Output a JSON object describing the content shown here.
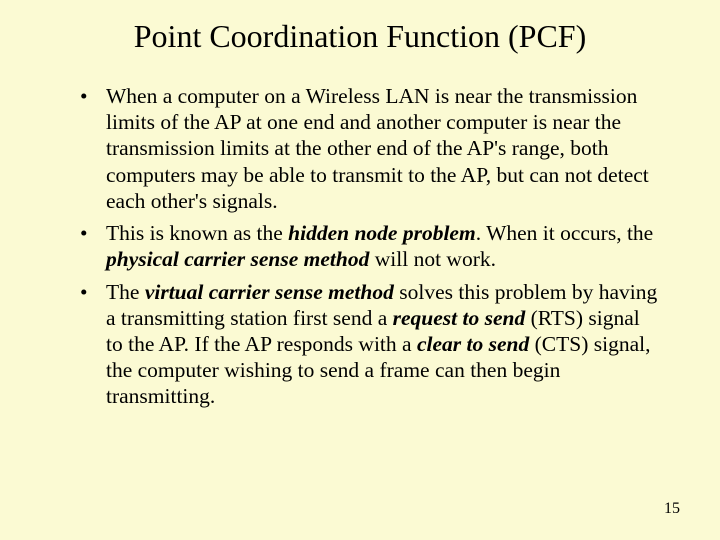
{
  "title": "Point Coordination Function (PCF)",
  "bullets": {
    "b1": {
      "t1": "When a computer on a Wireless LAN is near the transmission limits of the AP at one end and another computer is near the transmission limits at the other end of the AP's range, both computers may be able to transmit to the AP, but can not detect each other's signals."
    },
    "b2": {
      "t1": "This is known as the ",
      "e1": "hidden node problem",
      "t2": ". When it occurs, the ",
      "e2": "physical carrier sense method",
      "t3": " will not work."
    },
    "b3": {
      "t1": "The ",
      "e1": "virtual carrier sense method",
      "t2": " solves this problem by having a transmitting station first send a ",
      "e2": "request to send",
      "t3": " (RTS) signal to the AP. If the AP responds with a ",
      "e3": "clear to send",
      "t4": " (CTS) signal, the computer wishing to send a frame can then begin transmitting."
    }
  },
  "page_number": "15"
}
